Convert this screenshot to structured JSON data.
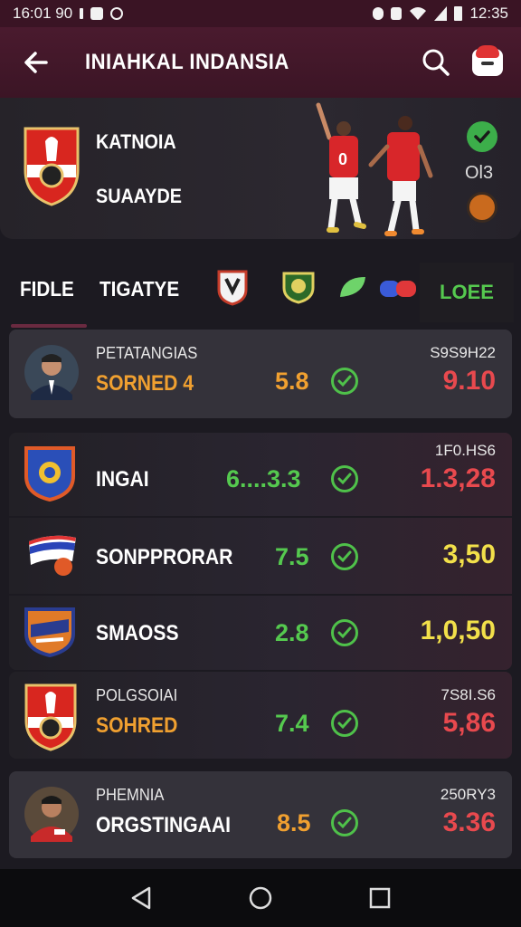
{
  "status_bar": {
    "time": "16:01 90",
    "clock": "12:35"
  },
  "header": {
    "title": "INIAHKAL INDANSIA"
  },
  "match": {
    "home_team": "KATNOIA",
    "away_team": "SUAAYDE",
    "score": "Ol3"
  },
  "tabs": {
    "tab1": "FIDLE",
    "tab2": "TIGATYE",
    "live_tab": "LOEE"
  },
  "rows": [
    {
      "top": "PETATANGIAS",
      "main": "SORNED 4",
      "value": "5.8",
      "extra": "S9S9H22",
      "odd": "9.10",
      "main_color": "#f0a030",
      "value_color": "#f0a030",
      "odd_color": "#e8494e"
    },
    {
      "top": "",
      "main": "INGAI",
      "value": "6....3.3",
      "extra": "1F0.HS6",
      "odd": "1.3,28",
      "main_color": "#ffffff",
      "value_color": "#55c94f",
      "odd_color": "#e8494e"
    },
    {
      "top": "",
      "main": "SONPPRORAR",
      "value": "7.5",
      "extra": "",
      "odd": "3,50",
      "main_color": "#ffffff",
      "value_color": "#55c94f",
      "odd_color": "#f2e04a"
    },
    {
      "top": "",
      "main": "SMAOSS",
      "value": "2.8",
      "extra": "",
      "odd": "1,0,50",
      "main_color": "#ffffff",
      "value_color": "#55c94f",
      "odd_color": "#f2e04a"
    },
    {
      "top": "POLGSOIAI",
      "main": "SOHRED",
      "value": "7.4",
      "extra": "7S8I.S6",
      "odd": "5,86",
      "main_color": "#f0a030",
      "value_color": "#55c94f",
      "odd_color": "#e8494e"
    },
    {
      "top": "PHEMNIA",
      "main": "ORGSTINGAAI",
      "value": "8.5",
      "extra": "250RY3",
      "odd": "3.36",
      "main_color": "#ffffff",
      "value_color": "#f0a030",
      "odd_color": "#e8494e"
    }
  ],
  "colors": {
    "accent": "#3a1424",
    "green": "#55c94f",
    "orange": "#f0a030",
    "red": "#e8494e",
    "yellow": "#f2e04a"
  }
}
